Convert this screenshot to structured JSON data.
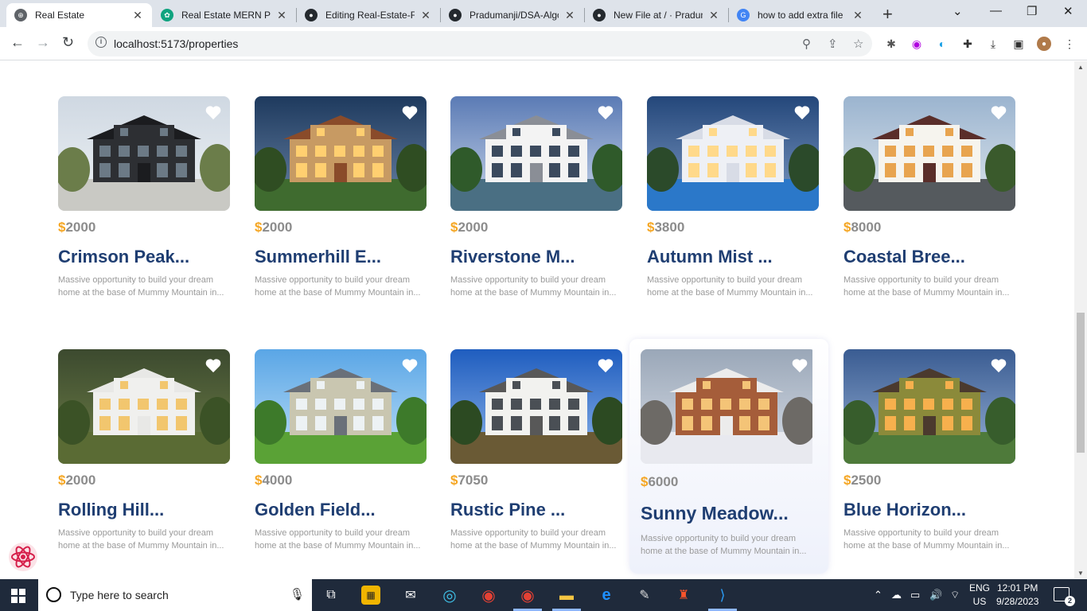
{
  "browser": {
    "tabs": [
      {
        "title": "Real Estate",
        "active": true,
        "favicon": "globe-icon",
        "color": "#5f6368"
      },
      {
        "title": "Real Estate MERN Pro",
        "active": false,
        "favicon": "chatgpt-icon",
        "color": "#10a37f"
      },
      {
        "title": "Editing Real-Estate-Fu",
        "active": false,
        "favicon": "github-icon",
        "color": "#24292e"
      },
      {
        "title": "Pradumanji/DSA-Algo",
        "active": false,
        "favicon": "github-icon",
        "color": "#24292e"
      },
      {
        "title": "New File at / · Pradum",
        "active": false,
        "favicon": "github-icon",
        "color": "#24292e"
      },
      {
        "title": "how to add extra file",
        "active": false,
        "favicon": "google-icon",
        "color": "#4285f4"
      }
    ],
    "url": "localhost:5173/properties"
  },
  "properties": [
    {
      "price": "2000",
      "name": "Crimson Peak...",
      "desc": "Massive opportunity to build your dream home at the base of Mummy Mountain in...",
      "scene": "modern-dark"
    },
    {
      "price": "2000",
      "name": "Summerhill E...",
      "desc": "Massive opportunity to build your dream home at the base of Mummy Mountain in...",
      "scene": "villa-dusk"
    },
    {
      "price": "2000",
      "name": "Riverstone M...",
      "desc": "Massive opportunity to build your dream home at the base of Mummy Mountain in...",
      "scene": "white-palms"
    },
    {
      "price": "3800",
      "name": "Autumn Mist ...",
      "desc": "Massive opportunity to build your dream home at the base of Mummy Mountain in...",
      "scene": "mansion-pool"
    },
    {
      "price": "8000",
      "name": "Coastal Bree...",
      "desc": "Massive opportunity to build your dream home at the base of Mummy Mountain in...",
      "scene": "tropical-house"
    },
    {
      "price": "2000",
      "name": "Rolling Hill...",
      "desc": "Massive opportunity to build your dream home at the base of Mummy Mountain in...",
      "scene": "hillside-lux"
    },
    {
      "price": "4000",
      "name": "Golden Field...",
      "desc": "Massive opportunity to build your dream home at the base of Mummy Mountain in...",
      "scene": "craftsman"
    },
    {
      "price": "7050",
      "name": "Rustic Pine ...",
      "desc": "Massive opportunity to build your dream home at the base of Mummy Mountain in...",
      "scene": "victorian"
    },
    {
      "price": "6000",
      "name": "Sunny Meadow...",
      "desc": "Massive opportunity to build your dream home at the base of Mummy Mountain in...",
      "scene": "snow-modern"
    },
    {
      "price": "2500",
      "name": "Blue Horizon...",
      "desc": "Massive opportunity to build your dream home at the base of Mummy Mountain in...",
      "scene": "suburban-dusk"
    }
  ],
  "currency_symbol": "$",
  "colors": {
    "accent": "#f5a623",
    "title": "#1f3e72",
    "muted": "#9a9a9a"
  },
  "taskbar": {
    "search_placeholder": "Type here to search",
    "lang_line1": "ENG",
    "lang_line2": "US",
    "time": "12:01 PM",
    "date": "9/28/2023",
    "notification_count": "2"
  }
}
